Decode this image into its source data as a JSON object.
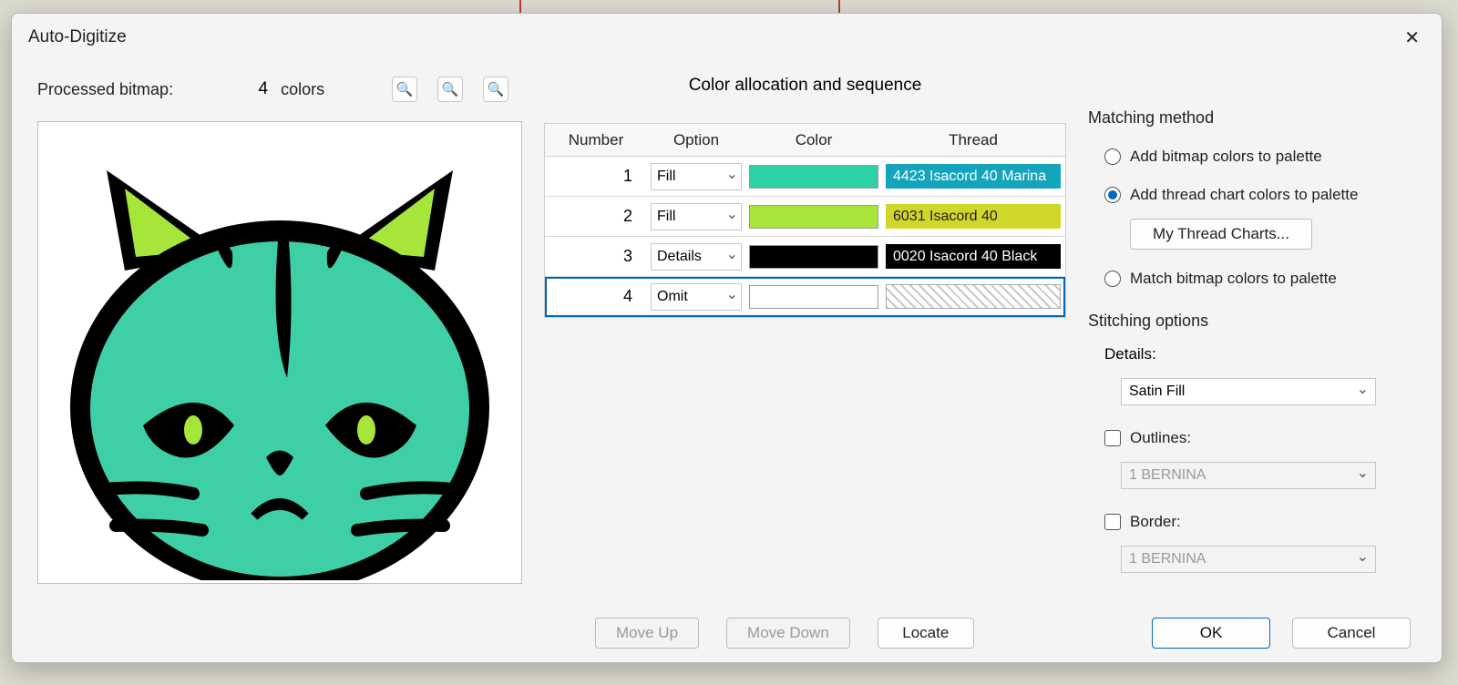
{
  "window": {
    "title": "Auto-Digitize"
  },
  "left": {
    "processed_bitmap_label": "Processed bitmap:",
    "color_count": "4",
    "colors_label": "colors"
  },
  "center": {
    "heading": "Color allocation and sequence",
    "headers": {
      "number": "Number",
      "option": "Option",
      "color": "Color",
      "thread": "Thread"
    },
    "rows": [
      {
        "num": "1",
        "option": "Fill",
        "swatch": "#2dd1a6",
        "thread_bg": "#14a5bd",
        "thread_text": "4423 Isacord 40 Marina",
        "thread_fg": "#fff"
      },
      {
        "num": "2",
        "option": "Fill",
        "swatch": "#a6e63b",
        "thread_bg": "#cfd72b",
        "thread_text": "6031 Isacord 40",
        "thread_fg": "#222"
      },
      {
        "num": "3",
        "option": "Details",
        "swatch": "#000000",
        "thread_bg": "#000000",
        "thread_text": "0020 Isacord 40 Black",
        "thread_fg": "#fff"
      },
      {
        "num": "4",
        "option": "Omit",
        "swatch": "#ffffff",
        "thread_bg": "",
        "thread_text": "",
        "thread_fg": ""
      }
    ]
  },
  "right": {
    "matching_label": "Matching method",
    "opt_add_bitmap": "Add bitmap colors to palette",
    "opt_add_thread": "Add thread chart colors to palette",
    "my_thread_charts": "My Thread Charts...",
    "opt_match_bitmap": "Match bitmap colors to palette",
    "stitching_label": "Stitching options",
    "details_label": "Details:",
    "details_value": "Satin Fill",
    "outlines_label": "Outlines:",
    "outlines_value": "1 BERNINA",
    "border_label": "Border:",
    "border_value": "1 BERNINA"
  },
  "footer": {
    "move_up": "Move Up",
    "move_down": "Move Down",
    "locate": "Locate",
    "ok": "OK",
    "cancel": "Cancel"
  }
}
